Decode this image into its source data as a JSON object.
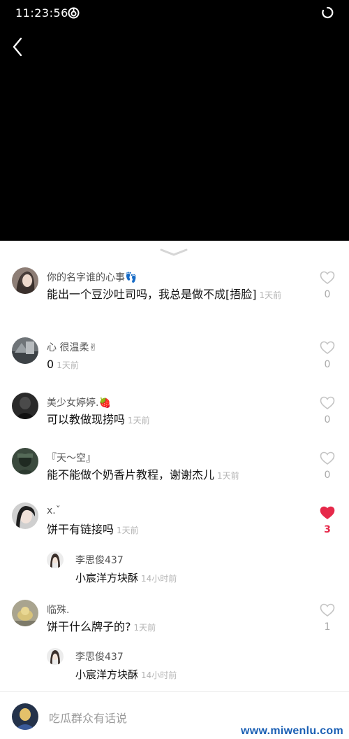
{
  "status_bar": {
    "time": "11:23:56"
  },
  "comments": [
    {
      "user": "你的名字谁的心事👣",
      "text": "能出一个豆沙吐司吗，我总是做不成[捂脸]",
      "time": "1天前",
      "likes": "0",
      "liked": false
    },
    {
      "user": "心  很温柔✌",
      "text": "0",
      "time": "1天前",
      "likes": "0",
      "liked": false
    },
    {
      "user": "美少女婷婷.🍓",
      "text": "可以教做现捞吗",
      "time": "1天前",
      "likes": "0",
      "liked": false
    },
    {
      "user": "『天～空』",
      "text": "能不能做个奶香片教程，谢谢杰儿",
      "time": "1天前",
      "likes": "0",
      "liked": false
    },
    {
      "user": "x.ˇ",
      "text": "饼干有链接吗",
      "time": "1天前",
      "likes": "3",
      "liked": true
    },
    {
      "user": "临殊.",
      "text": "饼干什么牌子的?",
      "time": "1天前",
      "likes": "1",
      "liked": false
    }
  ],
  "replies": [
    {
      "user": "李思俊437",
      "text": "小宸洋方块酥",
      "time": "14小时前"
    },
    {
      "user": "李思俊437",
      "text": "小宸洋方块酥",
      "time": "14小时前"
    }
  ],
  "input": {
    "placeholder": "吃瓜群众有话说"
  },
  "watermark": "www.miwenlu.com",
  "colors": {
    "like_active": "#e6294a",
    "video_bg": "#000000",
    "watermark": "#1a5fb4"
  },
  "icons": {
    "back": "chevron-left-icon",
    "collapse": "chevron-down-icon",
    "like": "heart-icon",
    "loading": "loading-icon",
    "status_app": "app-icon"
  }
}
